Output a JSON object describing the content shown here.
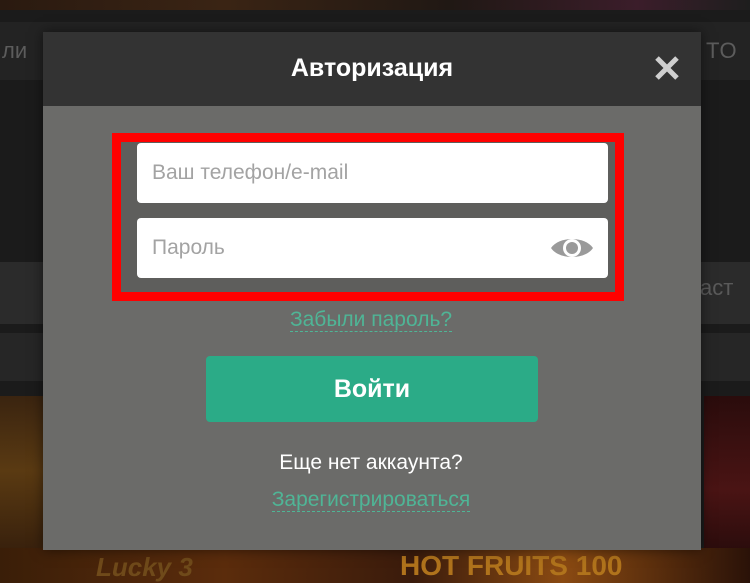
{
  "background": {
    "nav_left_text": "ли",
    "nav_right_text": "ТО",
    "band_right_text": "аст",
    "game_bottom_left": "Lucky 3",
    "game_bottom_right": "HOT FRUITS 100"
  },
  "modal": {
    "title": "Авторизация",
    "close_icon": "close-icon",
    "email": {
      "placeholder": "Ваш телефон/e-mail",
      "value": ""
    },
    "password": {
      "placeholder": "Пароль",
      "value": "",
      "toggle_icon": "eye-icon"
    },
    "forgot_password": "Забыли пароль?",
    "login_button": "Войти",
    "no_account_text": "Еще нет аккаунта?",
    "register_link": "Зарегистрироваться"
  },
  "colors": {
    "accent": "#2bab87",
    "link": "#4fb596",
    "highlight": "#ff0000",
    "modal_bg": "#6b6b69",
    "header_bg": "#333333"
  }
}
